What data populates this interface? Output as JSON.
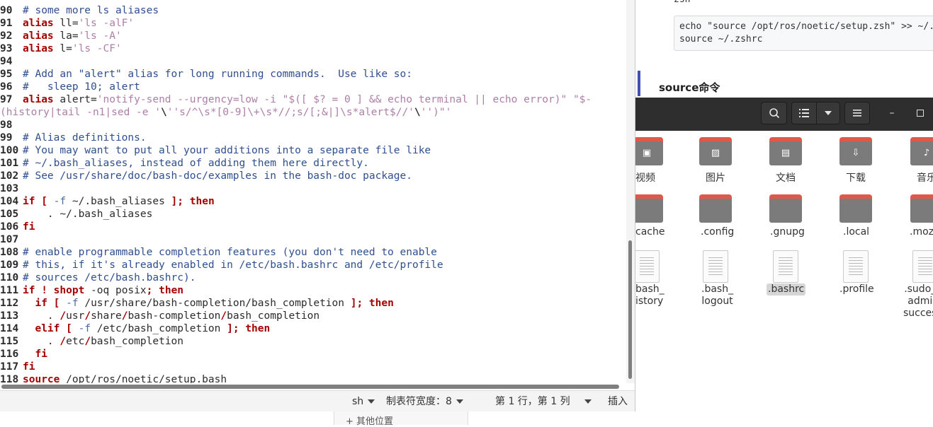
{
  "browser_bg": {
    "partial_heading": "zsh",
    "code_lines": [
      "echo \"source /opt/ros/noetic/setup.zsh\" >> ~/.z",
      "source ~/.zshrc"
    ],
    "section_heading": "source命令",
    "sidebar_other_places": "+  其他位置"
  },
  "file_manager": {
    "header_icons": [
      "search-icon",
      "list-view-icon",
      "chevron-down-icon",
      "menu-icon",
      "minimize-icon",
      "maximize-icon"
    ],
    "folders_row1": [
      {
        "label": "视频",
        "icon": "video-icon"
      },
      {
        "label": "图片",
        "icon": "image-icon"
      },
      {
        "label": "文档",
        "icon": "document-icon"
      },
      {
        "label": "下载",
        "icon": "download-icon"
      },
      {
        "label": "音乐",
        "icon": "music-icon"
      }
    ],
    "folders_row2": [
      {
        "label": "cache"
      },
      {
        "label": ".config"
      },
      {
        "label": ".gnupg"
      },
      {
        "label": ".local"
      },
      {
        "label": ".moz"
      }
    ],
    "files_row3": [
      {
        "label": "bash_\nistory"
      },
      {
        "label": ".bash_\nlogout"
      },
      {
        "label": ".bashrc",
        "selected": true
      },
      {
        "label": ".profile"
      },
      {
        "label": ".sudo_\nadmi\nsucces"
      }
    ]
  },
  "editor": {
    "lines": [
      {
        "n": "90",
        "t": [
          [
            "cm",
            "# some more ls aliases"
          ]
        ]
      },
      {
        "n": "91",
        "t": [
          [
            "kw",
            "alias"
          ],
          [
            "tx",
            " ll="
          ],
          [
            "st",
            "'ls -alF'"
          ]
        ]
      },
      {
        "n": "92",
        "t": [
          [
            "kw",
            "alias"
          ],
          [
            "tx",
            " la="
          ],
          [
            "st",
            "'ls -A'"
          ]
        ]
      },
      {
        "n": "93",
        "t": [
          [
            "kw",
            "alias"
          ],
          [
            "tx",
            " l="
          ],
          [
            "st",
            "'ls -CF'"
          ]
        ]
      },
      {
        "n": "94",
        "t": []
      },
      {
        "n": "95",
        "t": [
          [
            "cm",
            "# Add an \"alert\" alias for long running commands.  Use like so:"
          ]
        ]
      },
      {
        "n": "96",
        "t": [
          [
            "cm",
            "#   sleep 10; alert"
          ]
        ]
      },
      {
        "n": "97",
        "t": [
          [
            "kw",
            "alias"
          ],
          [
            "tx",
            " alert="
          ],
          [
            "st",
            "'notify-send --urgency=low -i \"$([ $? = 0 ] && echo terminal || echo error)\" \"$-"
          ]
        ]
      },
      {
        "n": "",
        "t": [
          [
            "st",
            "(history|tail -n1|sed -e '"
          ],
          [
            "sp",
            "\\"
          ],
          [
            "st",
            "''s/^\\s*[0-9]\\+\\s*//;s/[;&|]\\s*alert$//'"
          ],
          [
            "sp",
            "\\"
          ],
          [
            "st",
            "'')\"'"
          ]
        ]
      },
      {
        "n": "98",
        "t": []
      },
      {
        "n": "99",
        "t": [
          [
            "cm",
            "# Alias definitions."
          ]
        ]
      },
      {
        "n": "100",
        "t": [
          [
            "cm",
            "# You may want to put all your additions into a separate file like"
          ]
        ]
      },
      {
        "n": "101",
        "t": [
          [
            "cm",
            "# ~/.bash_aliases, instead of adding them here directly."
          ]
        ]
      },
      {
        "n": "102",
        "t": [
          [
            "cm",
            "# See /usr/share/doc/bash-doc/examples in the bash-doc package."
          ]
        ]
      },
      {
        "n": "103",
        "t": []
      },
      {
        "n": "104",
        "t": [
          [
            "kw",
            "if"
          ],
          [
            "tx",
            " "
          ],
          [
            "kw",
            "["
          ],
          [
            "tx",
            " "
          ],
          [
            "fl",
            "-f"
          ],
          [
            "tx",
            " ~/.bash_aliases "
          ],
          [
            "kw",
            "];"
          ],
          [
            "tx",
            " "
          ],
          [
            "kw",
            "then"
          ]
        ]
      },
      {
        "n": "105",
        "t": [
          [
            "tx",
            "    . ~/.bash_aliases"
          ]
        ]
      },
      {
        "n": "106",
        "t": [
          [
            "kw",
            "fi"
          ]
        ]
      },
      {
        "n": "107",
        "t": []
      },
      {
        "n": "108",
        "t": [
          [
            "cm",
            "# enable programmable completion features (you don't need to enable"
          ]
        ]
      },
      {
        "n": "109",
        "t": [
          [
            "cm",
            "# this, if it's already enabled in /etc/bash.bashrc and /etc/profile"
          ]
        ]
      },
      {
        "n": "110",
        "t": [
          [
            "cm",
            "# sources /etc/bash.bashrc)."
          ]
        ]
      },
      {
        "n": "111",
        "t": [
          [
            "kw",
            "if"
          ],
          [
            "tx",
            " "
          ],
          [
            "kw",
            "!"
          ],
          [
            "tx",
            " "
          ],
          [
            "kw",
            "shopt"
          ],
          [
            "tx",
            " -oq posix"
          ],
          [
            "kw",
            ";"
          ],
          [
            "tx",
            " "
          ],
          [
            "kw",
            "then"
          ]
        ]
      },
      {
        "n": "112",
        "t": [
          [
            "tx",
            "  "
          ],
          [
            "kw",
            "if"
          ],
          [
            "tx",
            " "
          ],
          [
            "kw",
            "["
          ],
          [
            "tx",
            " "
          ],
          [
            "fl",
            "-f"
          ],
          [
            "tx",
            " /usr/share/bash-completion/bash_completion "
          ],
          [
            "kw",
            "];"
          ],
          [
            "tx",
            " "
          ],
          [
            "kw",
            "then"
          ]
        ]
      },
      {
        "n": "113",
        "t": [
          [
            "tx",
            "    . "
          ],
          [
            "kw",
            "/"
          ],
          [
            "tx",
            "usr"
          ],
          [
            "kw",
            "/"
          ],
          [
            "tx",
            "share"
          ],
          [
            "kw",
            "/"
          ],
          [
            "tx",
            "bash-completion"
          ],
          [
            "kw",
            "/"
          ],
          [
            "tx",
            "bash_completion"
          ]
        ]
      },
      {
        "n": "114",
        "t": [
          [
            "tx",
            "  "
          ],
          [
            "kw",
            "elif"
          ],
          [
            "tx",
            " "
          ],
          [
            "kw",
            "["
          ],
          [
            "tx",
            " "
          ],
          [
            "fl",
            "-f"
          ],
          [
            "tx",
            " /etc/bash_completion "
          ],
          [
            "kw",
            "];"
          ],
          [
            "tx",
            " "
          ],
          [
            "kw",
            "then"
          ]
        ]
      },
      {
        "n": "115",
        "t": [
          [
            "tx",
            "    . "
          ],
          [
            "kw",
            "/"
          ],
          [
            "tx",
            "etc"
          ],
          [
            "kw",
            "/"
          ],
          [
            "tx",
            "bash_completion"
          ]
        ]
      },
      {
        "n": "116",
        "t": [
          [
            "tx",
            "  "
          ],
          [
            "kw",
            "fi"
          ]
        ]
      },
      {
        "n": "117",
        "t": [
          [
            "kw",
            "fi"
          ]
        ]
      },
      {
        "n": "118",
        "t": [
          [
            "kw",
            "source"
          ],
          [
            "tx",
            " /opt/ros/noetic/setup.bash"
          ]
        ]
      }
    ],
    "status": {
      "language": "sh",
      "tab_width": "制表符宽度：8",
      "position": "第 1 行，第 1 列",
      "mode": "插入"
    }
  }
}
